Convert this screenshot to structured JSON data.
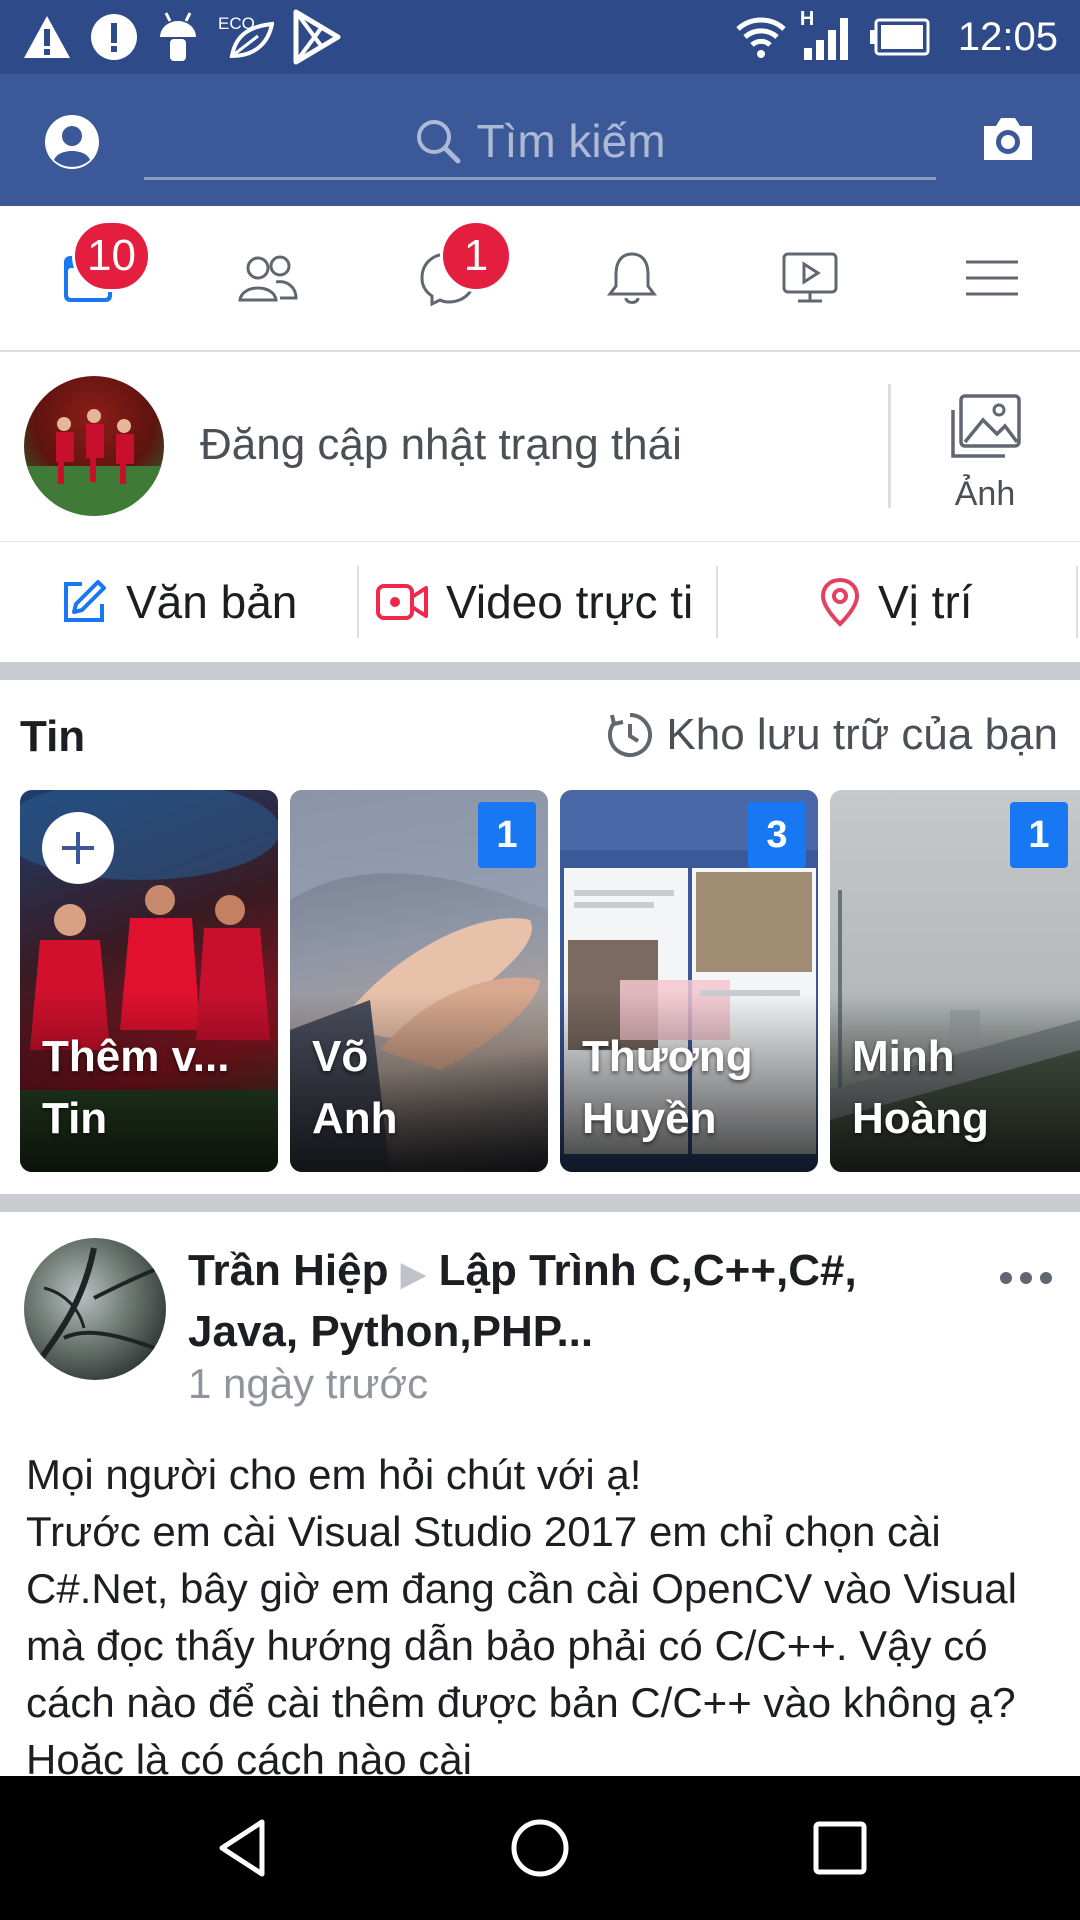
{
  "status_bar": {
    "time": "12:05",
    "network_type": "H",
    "eco_label": "ECO",
    "icons": [
      "warning-icon",
      "alert-icon",
      "android-icon",
      "eco-leaf-icon",
      "play-store-icon",
      "wifi-icon",
      "signal-icon",
      "battery-icon"
    ]
  },
  "header": {
    "search_placeholder": "Tìm kiếm",
    "icons": [
      "profile-icon",
      "search-icon",
      "camera-icon"
    ]
  },
  "nav_tabs": [
    {
      "name": "news-feed",
      "icon": "news-feed-icon",
      "badge": "10"
    },
    {
      "name": "friends",
      "icon": "friends-icon",
      "badge": ""
    },
    {
      "name": "messenger",
      "icon": "messenger-icon",
      "badge": "1"
    },
    {
      "name": "notifications",
      "icon": "bell-icon",
      "badge": ""
    },
    {
      "name": "watch",
      "icon": "watch-icon",
      "badge": ""
    },
    {
      "name": "menu",
      "icon": "menu-icon",
      "badge": ""
    }
  ],
  "composer": {
    "prompt": "Đăng cập nhật trạng thái",
    "photo_label": "Ảnh"
  },
  "actions": {
    "text_label": "Văn bản",
    "video_label": "Video trực ti",
    "location_label": "Vị trí"
  },
  "stories": {
    "title": "Tin",
    "archive_label": "Kho lưu trữ của bạn",
    "items": [
      {
        "line1": "Thêm v...",
        "line2": "Tin",
        "count": ""
      },
      {
        "line1": "Võ",
        "line2": "Anh",
        "count": "1"
      },
      {
        "line1": "Thương",
        "line2": "Huyền",
        "count": "3"
      },
      {
        "line1": "Minh",
        "line2": "Hoàng",
        "count": "1"
      }
    ]
  },
  "post": {
    "author": "Trần Hiệp",
    "arrow": "▶",
    "group": "Lập Trình C,C++,C#, Java, Python,PHP...",
    "time": "1 ngày trước",
    "body": "Mọi người cho em hỏi chút với ạ!\nTrước em cài Visual Studio 2017 em chỉ chọn cài C#.Net, bây giờ em đang cần cài OpenCV vào Visual mà đọc thấy hướng dẫn bảo phải có C/C++. Vậy có cách nào để cài thêm được bản C/C++ vào không ạ? Hoặc là có cách nào cài"
  },
  "colors": {
    "status_bar": "#2e4a88",
    "header": "#3b5998",
    "badge": "#e41e3f",
    "accent_blue": "#1877f2",
    "video_red": "#f02849",
    "location_pink": "#e4405f"
  }
}
